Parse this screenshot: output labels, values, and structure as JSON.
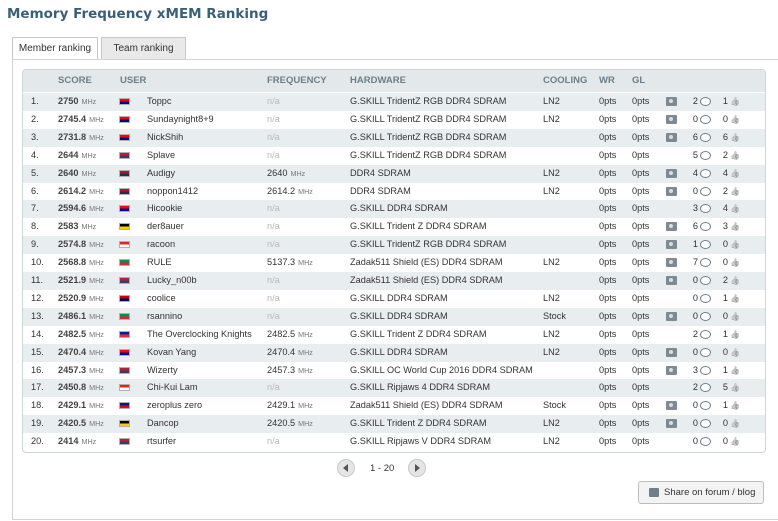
{
  "page": {
    "title": "Memory Frequency xMEM Ranking"
  },
  "tabs": [
    {
      "label": "Member ranking",
      "active": true
    },
    {
      "label": "Team ranking",
      "active": false
    }
  ],
  "columns": {
    "score": "SCORE",
    "user": "USER",
    "frequency": "FREQUENCY",
    "hardware": "HARDWARE",
    "cooling": "COOLING",
    "wr": "WR",
    "gl": "GL"
  },
  "unit": "MHz",
  "na_text": "n/a",
  "rows": [
    {
      "rank": "1.",
      "score": "2750",
      "flag_colors": [
        "#fe0000",
        "#000095"
      ],
      "user": "Toppc",
      "frequency": "n/a",
      "hardware": "G.SKILL TridentZ RGB DDR4 SDRAM",
      "cooling": "LN2",
      "wr": "0pts",
      "gl": "0pts",
      "has_camera": true,
      "comments": "2",
      "likes": "1"
    },
    {
      "rank": "2.",
      "score": "2745.4",
      "flag_colors": [
        "#fe0000",
        "#000095"
      ],
      "user": "Sundaynight8+9",
      "frequency": "n/a",
      "hardware": "G.SKILL TridentZ RGB DDR4 SDRAM",
      "cooling": "LN2",
      "wr": "0pts",
      "gl": "0pts",
      "has_camera": true,
      "comments": "0",
      "likes": "0"
    },
    {
      "rank": "3.",
      "score": "2731.8",
      "flag_colors": [
        "#fe0000",
        "#000095"
      ],
      "user": "NickShih",
      "frequency": "n/a",
      "hardware": "G.SKILL TridentZ RGB DDR4 SDRAM",
      "cooling": "",
      "wr": "0pts",
      "gl": "0pts",
      "has_camera": true,
      "comments": "6",
      "likes": "6"
    },
    {
      "rank": "4.",
      "score": "2644",
      "flag_colors": [
        "#b22234",
        "#3c3b6e"
      ],
      "user": "Splave",
      "frequency": "n/a",
      "hardware": "G.SKILL TridentZ RGB DDR4 SDRAM",
      "cooling": "",
      "wr": "0pts",
      "gl": "0pts",
      "has_camera": false,
      "comments": "5",
      "likes": "2"
    },
    {
      "rank": "5.",
      "score": "2640",
      "flag_colors": [
        "#a51931",
        "#2d2a4a"
      ],
      "user": "Audigy",
      "frequency": "2640",
      "hardware": "DDR4 SDRAM",
      "cooling": "LN2",
      "wr": "0pts",
      "gl": "0pts",
      "has_camera": true,
      "comments": "4",
      "likes": "4"
    },
    {
      "rank": "6.",
      "score": "2614.2",
      "flag_colors": [
        "#a51931",
        "#2d2a4a"
      ],
      "user": "noppon1412",
      "frequency": "2614.2",
      "hardware": "DDR4 SDRAM",
      "cooling": "LN2",
      "wr": "0pts",
      "gl": "0pts",
      "has_camera": true,
      "comments": "0",
      "likes": "2"
    },
    {
      "rank": "7.",
      "score": "2594.6",
      "flag_colors": [
        "#fe0000",
        "#000095"
      ],
      "user": "Hicookie",
      "frequency": "n/a",
      "hardware": "G.SKILL DDR4 SDRAM",
      "cooling": "",
      "wr": "0pts",
      "gl": "0pts",
      "has_camera": false,
      "comments": "3",
      "likes": "4"
    },
    {
      "rank": "8.",
      "score": "2583",
      "flag_colors": [
        "#000000",
        "#ffce00"
      ],
      "user": "der8auer",
      "frequency": "n/a",
      "hardware": "G.SKILL Trident Z DDR4 SDRAM",
      "cooling": "",
      "wr": "0pts",
      "gl": "0pts",
      "has_camera": true,
      "comments": "6",
      "likes": "3"
    },
    {
      "rank": "9.",
      "score": "2574.8",
      "flag_colors": [
        "#d52b1e",
        "#ffffff"
      ],
      "user": "racoon",
      "frequency": "n/a",
      "hardware": "G.SKILL TridentZ RGB DDR4 SDRAM",
      "cooling": "",
      "wr": "0pts",
      "gl": "0pts",
      "has_camera": true,
      "comments": "1",
      "likes": "0"
    },
    {
      "rank": "10.",
      "score": "2568.8",
      "flag_colors": [
        "#009246",
        "#ce2b37"
      ],
      "user": "RULE",
      "frequency": "5137.3",
      "hardware": "Zadak511 Shield (ES) DDR4 SDRAM",
      "cooling": "LN2",
      "wr": "0pts",
      "gl": "0pts",
      "has_camera": true,
      "comments": "7",
      "likes": "0"
    },
    {
      "rank": "11.",
      "score": "2521.9",
      "flag_colors": [
        "#b22234",
        "#3c3b6e"
      ],
      "user": "Lucky_n00b",
      "frequency": "n/a",
      "hardware": "Zadak511 Shield (ES) DDR4 SDRAM",
      "cooling": "",
      "wr": "0pts",
      "gl": "0pts",
      "has_camera": true,
      "comments": "0",
      "likes": "2"
    },
    {
      "rank": "12.",
      "score": "2520.9",
      "flag_colors": [
        "#cc0001",
        "#010066"
      ],
      "user": "coolice",
      "frequency": "n/a",
      "hardware": "G.SKILL DDR4 SDRAM",
      "cooling": "LN2",
      "wr": "0pts",
      "gl": "0pts",
      "has_camera": false,
      "comments": "0",
      "likes": "1"
    },
    {
      "rank": "13.",
      "score": "2486.1",
      "flag_colors": [
        "#009246",
        "#ce2b37"
      ],
      "user": "rsannino",
      "frequency": "n/a",
      "hardware": "G.SKILL DDR4 SDRAM",
      "cooling": "Stock",
      "wr": "0pts",
      "gl": "0pts",
      "has_camera": true,
      "comments": "0",
      "likes": "0"
    },
    {
      "rank": "14.",
      "score": "2482.5",
      "flag_colors": [
        "#002395",
        "#ed2939"
      ],
      "user": "The Overclocking Knights",
      "frequency": "2482.5",
      "hardware": "G.SKILL Trident Z DDR4 SDRAM",
      "cooling": "LN2",
      "wr": "0pts",
      "gl": "0pts",
      "has_camera": false,
      "comments": "2",
      "likes": "1"
    },
    {
      "rank": "15.",
      "score": "2470.4",
      "flag_colors": [
        "#fe0000",
        "#000095"
      ],
      "user": "Kovan Yang",
      "frequency": "2470.4",
      "hardware": "G.SKILL DDR4 SDRAM",
      "cooling": "LN2",
      "wr": "0pts",
      "gl": "0pts",
      "has_camera": true,
      "comments": "0",
      "likes": "0"
    },
    {
      "rank": "16.",
      "score": "2457.3",
      "flag_colors": [
        "#b22234",
        "#3c3b6e"
      ],
      "user": "Wizerty",
      "frequency": "2457.3",
      "hardware": "G.SKILL OC World Cup 2016 DDR4 SDRAM",
      "cooling": "",
      "wr": "0pts",
      "gl": "0pts",
      "has_camera": true,
      "comments": "3",
      "likes": "1"
    },
    {
      "rank": "17.",
      "score": "2450.8",
      "flag_colors": [
        "#de2910",
        "#ffffff"
      ],
      "user": "Chi-Kui Lam",
      "frequency": "n/a",
      "hardware": "G.SKILL Ripjaws 4 DDR4 SDRAM",
      "cooling": "",
      "wr": "0pts",
      "gl": "0pts",
      "has_camera": false,
      "comments": "2",
      "likes": "5"
    },
    {
      "rank": "18.",
      "score": "2429.1",
      "flag_colors": [
        "#012169",
        "#e4002b"
      ],
      "user": "zeroplus zero",
      "frequency": "2429.1",
      "hardware": "Zadak511 Shield (ES) DDR4 SDRAM",
      "cooling": "Stock",
      "wr": "0pts",
      "gl": "0pts",
      "has_camera": true,
      "comments": "0",
      "likes": "1"
    },
    {
      "rank": "19.",
      "score": "2420.5",
      "flag_colors": [
        "#000000",
        "#ffce00"
      ],
      "user": "Dancop",
      "frequency": "2420.5",
      "hardware": "G.SKILL Trident Z DDR4 SDRAM",
      "cooling": "LN2",
      "wr": "0pts",
      "gl": "0pts",
      "has_camera": true,
      "comments": "0",
      "likes": "0"
    },
    {
      "rank": "20.",
      "score": "2414",
      "flag_colors": [
        "#b22234",
        "#3c3b6e"
      ],
      "user": "rtsurfer",
      "frequency": "n/a",
      "hardware": "G.SKILL Ripjaws V DDR4 SDRAM",
      "cooling": "LN2",
      "wr": "0pts",
      "gl": "0pts",
      "has_camera": false,
      "comments": "0",
      "likes": "0"
    }
  ],
  "pagination": {
    "info": "1 - 20"
  },
  "share": {
    "label": "Share on forum / blog"
  }
}
